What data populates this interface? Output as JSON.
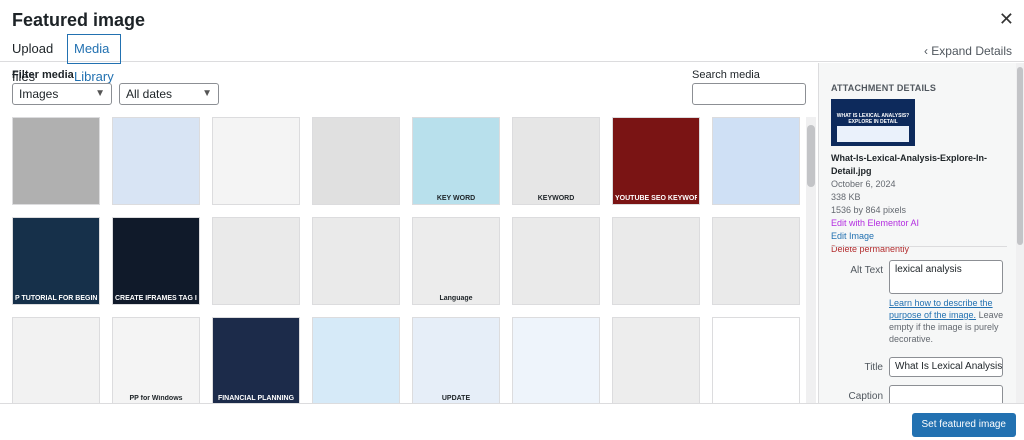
{
  "header": {
    "title": "Featured image",
    "close_glyph": "✕",
    "tabs": [
      {
        "label": "Upload files"
      },
      {
        "label": "Media Library"
      }
    ],
    "expand_label": "‹ Expand Details"
  },
  "filters": {
    "label": "Filter media",
    "type_value": "Images",
    "date_value": "All dates",
    "search_label": "Search media",
    "search_value": ""
  },
  "thumbnails": [
    {
      "label": "",
      "bg": "#b0b0b0"
    },
    {
      "label": "",
      "bg": "#d8e4f4"
    },
    {
      "label": "",
      "bg": "#f4f4f4"
    },
    {
      "label": "",
      "bg": "#e0e0e0"
    },
    {
      "label": "KEY WORD",
      "bg": "#b8e0ec"
    },
    {
      "label": "KEYWORD",
      "bg": "#e6e6e6"
    },
    {
      "label": "YOUTUBE SEO KEYWORDS",
      "bg": "#7a1414"
    },
    {
      "label": "",
      "bg": "#cfe0f5"
    },
    {
      "label": "P TUTORIAL FOR BEGINNE",
      "bg": "#16304a"
    },
    {
      "label": "CREATE IFRAMES TAG IN",
      "bg": "#101a2a"
    },
    {
      "label": "",
      "bg": "#eaeaea"
    },
    {
      "label": "",
      "bg": "#eaeaea"
    },
    {
      "label": "Language",
      "bg": "#ececec"
    },
    {
      "label": "",
      "bg": "#eaeaea"
    },
    {
      "label": "",
      "bg": "#eaeaea"
    },
    {
      "label": "",
      "bg": "#eaeaea"
    },
    {
      "label": "",
      "bg": "#f2f2f2"
    },
    {
      "label": "PP for Windows",
      "bg": "#f4f4f4"
    },
    {
      "label": "FINANCIAL PLANNING",
      "bg": "#1c2b4a"
    },
    {
      "label": "",
      "bg": "#d6eaf8"
    },
    {
      "label": "UPDATE",
      "bg": "#e6eef8"
    },
    {
      "label": "",
      "bg": "#eef4fb"
    },
    {
      "label": "",
      "bg": "#ededed"
    },
    {
      "label": "",
      "bg": "#ffffff"
    }
  ],
  "attachment": {
    "heading": "ATTACHMENT DETAILS",
    "thumb_title": "WHAT IS LEXICAL ANALYSIS? EXPLORE IN DETAIL",
    "filename": "What-Is-Lexical-Analysis-Explore-In-Detail.jpg",
    "date": "October 6, 2024",
    "size": "338 KB",
    "dimensions": "1536 by 864 pixels",
    "edit_elementor": "Edit with Elementor AI",
    "edit_image": "Edit Image",
    "delete": "Delete permanently",
    "alt_label": "Alt Text",
    "alt_value": "lexical analysis",
    "help_link": "Learn how to describe the purpose of the image.",
    "help_rest": " Leave empty if the image is purely decorative.",
    "title_label": "Title",
    "title_value": "What Is Lexical Analysis E",
    "caption_label": "Caption",
    "caption_value": ""
  },
  "footer": {
    "primary_label": "Set featured image"
  },
  "colors": {
    "accent": "#2271b1",
    "purple": "#b32de0",
    "danger": "#b32d2e"
  }
}
